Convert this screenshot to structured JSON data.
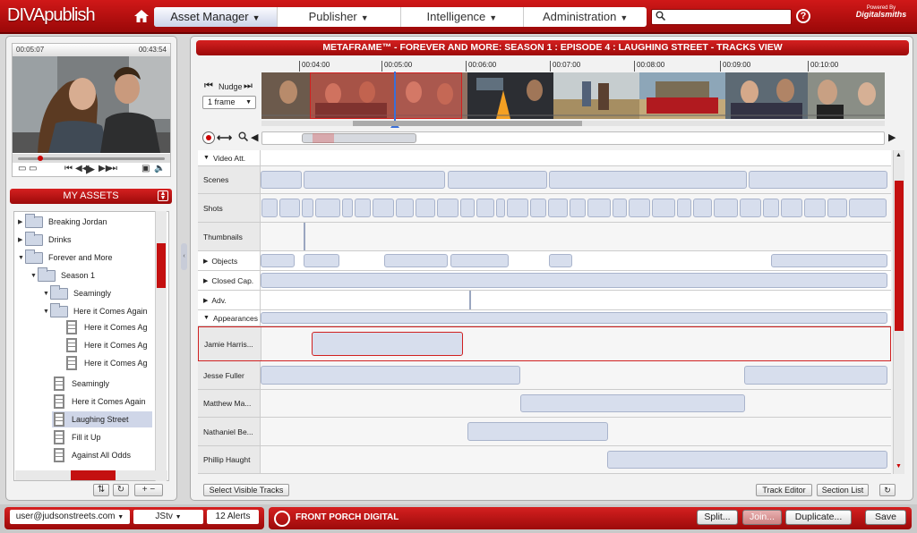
{
  "app": {
    "logo": "DIVApublish",
    "powered_by": "Powered By",
    "powered_brand": "Digitalsmiths"
  },
  "nav": {
    "tabs": [
      {
        "label": "Asset Manager",
        "active": true
      },
      {
        "label": "Publisher",
        "active": false
      },
      {
        "label": "Intelligence",
        "active": false
      },
      {
        "label": "Administration",
        "active": false
      }
    ],
    "search_value": "",
    "help_label": "?"
  },
  "player": {
    "current_time": "00:05:07",
    "duration": "00:43:54",
    "progress": 0.17
  },
  "assets": {
    "header": "MY ASSETS",
    "tree": [
      {
        "label": "Breaking Jordan",
        "type": "folder",
        "expand": "collapsed"
      },
      {
        "label": "Drinks",
        "type": "folder",
        "expand": "collapsed"
      },
      {
        "label": "Forever and More",
        "type": "folder",
        "expand": "expanded"
      },
      {
        "label": "Season 1",
        "type": "folder",
        "expand": "expanded"
      },
      {
        "label": "Seamingly",
        "type": "folder",
        "expand": "expanded"
      },
      {
        "label": "Here it Comes Again",
        "type": "folder",
        "expand": "expanded"
      },
      {
        "label": "Here it Comes Ag",
        "type": "film"
      },
      {
        "label": "Here it Comes Ag",
        "type": "film"
      },
      {
        "label": "Here it Comes Ag",
        "type": "film"
      },
      {
        "label": "Seamingly",
        "type": "film"
      },
      {
        "label": "Here it Comes Again",
        "type": "film"
      },
      {
        "label": "Laughing Street",
        "type": "film",
        "selected": true
      },
      {
        "label": "Fill it Up",
        "type": "film"
      },
      {
        "label": "Against All Odds",
        "type": "film"
      }
    ]
  },
  "view": {
    "title": "METAFRAME™ - FOREVER AND MORE: SEASON 1 : EPISODE 4 : LAUGHING STREET - TRACKS VIEW",
    "nudge_label": "Nudge",
    "frame_select": "1 frame",
    "time_ticks": [
      "00:04:00",
      "00:05:00",
      "00:06:00",
      "00:07:00",
      "00:08:00",
      "00:09:00",
      "00:10:00"
    ],
    "tracks": [
      {
        "label": "Video Att.",
        "kind": "header",
        "expand": "expanded"
      },
      {
        "label": "Scenes",
        "kind": "track"
      },
      {
        "label": "Shots",
        "kind": "track"
      },
      {
        "label": "Thumbnails",
        "kind": "track"
      },
      {
        "label": "Objects",
        "kind": "header",
        "expand": "collapsed"
      },
      {
        "label": "Closed Cap.",
        "kind": "header",
        "expand": "collapsed"
      },
      {
        "label": "Adv.",
        "kind": "header",
        "expand": "collapsed"
      },
      {
        "label": "Appearances",
        "kind": "header",
        "expand": "expanded"
      },
      {
        "label": "Jamie Harris...",
        "kind": "track",
        "selected": true
      },
      {
        "label": "Jesse Fuller",
        "kind": "track"
      },
      {
        "label": "Matthew Ma...",
        "kind": "track"
      },
      {
        "label": "Nathaniel Be...",
        "kind": "track"
      },
      {
        "label": "Phillip Haught",
        "kind": "track"
      }
    ],
    "buttons": {
      "select_visible": "Select Visible Tracks",
      "track_editor": "Track Editor",
      "section_list": "Section List"
    }
  },
  "footer": {
    "user": "user@judsonstreets.com",
    "channel": "JStv",
    "alerts": "12 Alerts",
    "brand": "FRONT PORCH DIGITAL",
    "actions": {
      "split": "Split...",
      "join": "Join...",
      "duplicate": "Duplicate...",
      "save": "Save"
    }
  },
  "colors": {
    "accent": "#c41010",
    "selection": "#cfd6e8",
    "segment": "#d7deed"
  }
}
